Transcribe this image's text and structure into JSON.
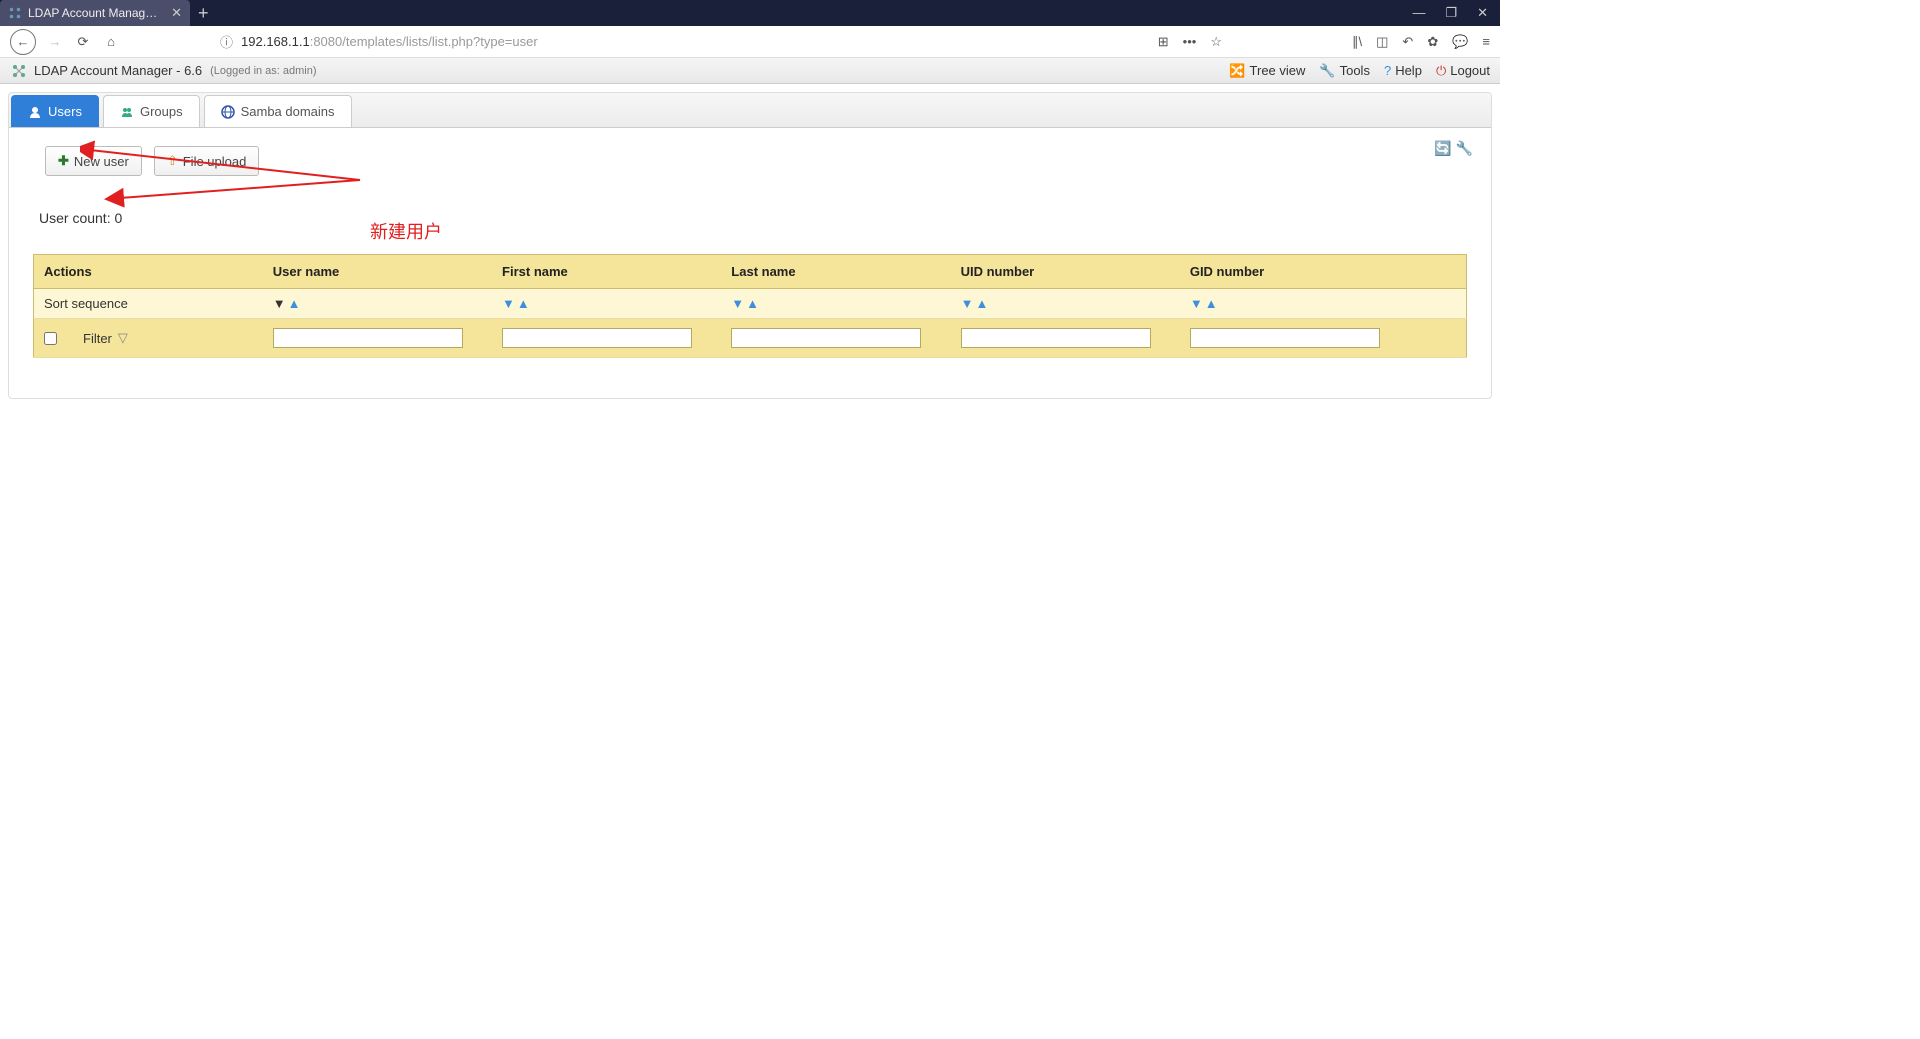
{
  "browser": {
    "tab_title": "LDAP Account Manager (ope",
    "url_prefix": "192.168.1.1",
    "url_rest": ":8080/templates/lists/list.php?type=user"
  },
  "app_header": {
    "title": "LDAP Account Manager - 6.6",
    "login_info": "(Logged in as: admin)",
    "links": {
      "tree_view": "Tree view",
      "tools": "Tools",
      "help": "Help",
      "logout": "Logout"
    }
  },
  "tabs": {
    "users": "Users",
    "groups": "Groups",
    "samba": "Samba domains"
  },
  "buttons": {
    "new_user": "New user",
    "file_upload": "File upload"
  },
  "count_text": "User count: 0",
  "table": {
    "headers": {
      "actions": "Actions",
      "username": "User name",
      "firstname": "First name",
      "lastname": "Last name",
      "uid": "UID number",
      "gid": "GID number"
    },
    "sort_label": "Sort sequence",
    "filter_label": "Filter"
  },
  "annotation": {
    "text": "新建用户"
  }
}
